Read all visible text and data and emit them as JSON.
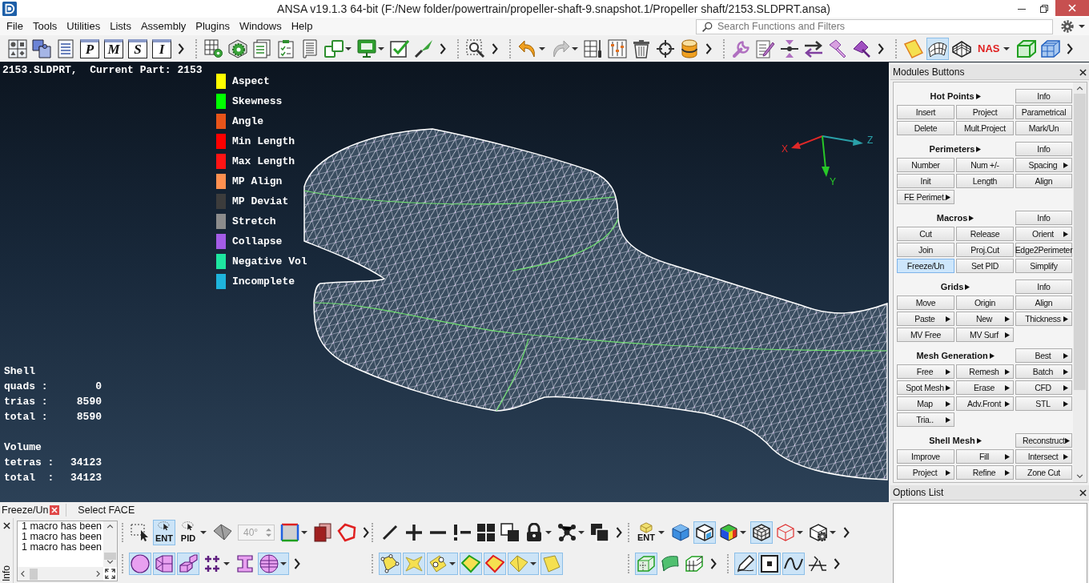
{
  "window": {
    "title": "ANSA v19.1.3 64-bit (F:/New folder/powertrain/propeller-shaft-9.snapshot.1/Propeller shaft/2153.SLDPRT.ansa)"
  },
  "menu": [
    "File",
    "Tools",
    "Utilities",
    "Lists",
    "Assembly",
    "Plugins",
    "Windows",
    "Help"
  ],
  "search": {
    "placeholder": "Search Functions and Filters"
  },
  "toolbar": [
    {
      "items": [
        {
          "kind": "icon",
          "on": false
        },
        {
          "kind": "icon",
          "on": false
        },
        {
          "kind": "icon",
          "on": false
        },
        {
          "kind": "letter",
          "label": "P",
          "on": false
        },
        {
          "kind": "letter",
          "label": "M",
          "on": false
        },
        {
          "kind": "letter",
          "label": "S",
          "on": false
        },
        {
          "kind": "letter",
          "label": "I",
          "on": false
        }
      ],
      "overflow": true
    },
    {
      "items": [
        {
          "kind": "icon",
          "on": false
        },
        {
          "kind": "icon",
          "on": false
        },
        {
          "kind": "icon",
          "on": false
        },
        {
          "kind": "icon",
          "on": false
        },
        {
          "kind": "icon",
          "on": false
        },
        {
          "kind": "icon",
          "on": false
        },
        {
          "kind": "icon",
          "on": false
        },
        {
          "kind": "icon",
          "on": false
        },
        {
          "kind": "icon",
          "on": false
        }
      ],
      "overflow": true
    },
    {
      "items": [
        {
          "kind": "icon",
          "on": false
        }
      ],
      "overflow": true
    },
    {
      "items": [
        {
          "kind": "icon",
          "on": false
        },
        {
          "kind": "icon",
          "on": false
        },
        {
          "kind": "icon",
          "on": false
        },
        {
          "kind": "icon",
          "on": false
        },
        {
          "kind": "icon",
          "on": false
        },
        {
          "kind": "icon",
          "on": false
        },
        {
          "kind": "icon",
          "on": false
        }
      ],
      "overflow": true
    },
    {
      "items": [
        {
          "kind": "icon",
          "on": false
        },
        {
          "kind": "icon",
          "on": false
        },
        {
          "kind": "icon",
          "on": false
        },
        {
          "kind": "icon",
          "on": false
        },
        {
          "kind": "icon",
          "on": false
        },
        {
          "kind": "icon",
          "on": false
        }
      ],
      "overflow": true
    },
    {
      "items": [
        {
          "kind": "icon",
          "on": false
        },
        {
          "kind": "icon",
          "on": true
        },
        {
          "kind": "icon",
          "on": false
        },
        {
          "kind": "text",
          "label": "NAS",
          "on": false
        },
        {
          "kind": "icon",
          "on": false
        },
        {
          "kind": "icon",
          "on": false
        }
      ],
      "overflow": true
    }
  ],
  "viewport": {
    "part_label": "2153.SLDPRT,  Current Part: 2153",
    "legend": [
      {
        "label": "Aspect",
        "color": "#ffff00"
      },
      {
        "label": "Skewness",
        "color": "#00ff00"
      },
      {
        "label": "Angle",
        "color": "#e8541a"
      },
      {
        "label": "Min Length",
        "color": "#ff0000"
      },
      {
        "label": "Max Length",
        "color": "#ff1414"
      },
      {
        "label": "MP Align",
        "color": "#ff9050"
      },
      {
        "label": "MP Deviat",
        "color": "#3c3c3c"
      },
      {
        "label": "Stretch",
        "color": "#8c8c8c"
      },
      {
        "label": "Collapse",
        "color": "#a35ce6"
      },
      {
        "label": "Negative Vol",
        "color": "#1ee6a0"
      },
      {
        "label": "Incomplete",
        "color": "#1eb4dc"
      }
    ],
    "axes": [
      {
        "label": "X"
      },
      {
        "label": "Z"
      },
      {
        "label": "Y"
      }
    ],
    "stats": [
      {
        "heading": "Shell",
        "rows": [
          {
            "label": "quads :",
            "value": "0"
          },
          {
            "label": "trias :",
            "value": "8590"
          },
          {
            "label": "total :",
            "value": "8590"
          }
        ]
      },
      {
        "heading": "Volume",
        "rows": [
          {
            "label": "tetras :",
            "value": "34123"
          },
          {
            "label": "total  :",
            "value": "34123"
          }
        ]
      }
    ]
  },
  "modules": {
    "title": "Modules Buttons",
    "sections": [
      {
        "title": "Hot Points",
        "side": {
          "label": "Info",
          "submenu": false,
          "selected": false
        },
        "rows": [
          [
            {
              "label": "Insert",
              "submenu": false,
              "selected": false
            },
            {
              "label": "Project",
              "submenu": false,
              "selected": false
            },
            {
              "label": "Parametrical",
              "submenu": false,
              "selected": false
            }
          ],
          [
            {
              "label": "Delete",
              "submenu": false,
              "selected": false
            },
            {
              "label": "Mult.Project",
              "submenu": false,
              "selected": false
            },
            {
              "label": "Mark/Un",
              "submenu": false,
              "selected": false
            }
          ]
        ]
      },
      {
        "title": "Perimeters",
        "side": {
          "label": "Info",
          "submenu": false,
          "selected": false
        },
        "rows": [
          [
            {
              "label": "Number",
              "submenu": false,
              "selected": false
            },
            {
              "label": "Num +/-",
              "submenu": false,
              "selected": false
            },
            {
              "label": "Spacing",
              "submenu": true,
              "selected": false
            }
          ],
          [
            {
              "label": "Init",
              "submenu": false,
              "selected": false
            },
            {
              "label": "Length",
              "submenu": false,
              "selected": false
            },
            {
              "label": "Align",
              "submenu": false,
              "selected": false
            }
          ],
          [
            {
              "label": "FE Perimet.",
              "submenu": true,
              "selected": false
            }
          ]
        ]
      },
      {
        "title": "Macros",
        "side": {
          "label": "Info",
          "submenu": false,
          "selected": false
        },
        "rows": [
          [
            {
              "label": "Cut",
              "submenu": false,
              "selected": false
            },
            {
              "label": "Release",
              "submenu": false,
              "selected": false
            },
            {
              "label": "Orient",
              "submenu": true,
              "selected": false
            }
          ],
          [
            {
              "label": "Join",
              "submenu": false,
              "selected": false
            },
            {
              "label": "Proj.Cut",
              "submenu": false,
              "selected": false
            },
            {
              "label": "Edge2Perimeter",
              "submenu": false,
              "selected": false
            }
          ],
          [
            {
              "label": "Freeze/Un",
              "submenu": false,
              "selected": true
            },
            {
              "label": "Set PID",
              "submenu": false,
              "selected": false
            },
            {
              "label": "Simplify",
              "submenu": false,
              "selected": false
            }
          ]
        ]
      },
      {
        "title": "Grids",
        "side": {
          "label": "Info",
          "submenu": false,
          "selected": false
        },
        "rows": [
          [
            {
              "label": "Move",
              "submenu": false,
              "selected": false
            },
            {
              "label": "Origin",
              "submenu": false,
              "selected": false
            },
            {
              "label": "Align",
              "submenu": false,
              "selected": false
            }
          ],
          [
            {
              "label": "Paste",
              "submenu": true,
              "selected": false
            },
            {
              "label": "New",
              "submenu": true,
              "selected": false
            },
            {
              "label": "Thickness",
              "submenu": true,
              "selected": false
            }
          ],
          [
            {
              "label": "MV Free",
              "submenu": false,
              "selected": false
            },
            {
              "label": "MV Surf",
              "submenu": true,
              "selected": false
            }
          ]
        ]
      },
      {
        "title": "Mesh Generation",
        "side": {
          "label": "Best",
          "submenu": true,
          "selected": false
        },
        "rows": [
          [
            {
              "label": "Free",
              "submenu": true,
              "selected": false
            },
            {
              "label": "Remesh",
              "submenu": true,
              "selected": false
            },
            {
              "label": "Batch",
              "submenu": true,
              "selected": false
            }
          ],
          [
            {
              "label": "Spot Mesh",
              "submenu": true,
              "selected": false
            },
            {
              "label": "Erase",
              "submenu": true,
              "selected": false
            },
            {
              "label": "CFD",
              "submenu": true,
              "selected": false
            }
          ],
          [
            {
              "label": "Map",
              "submenu": true,
              "selected": false
            },
            {
              "label": "Adv.Front",
              "submenu": true,
              "selected": false
            },
            {
              "label": "STL",
              "submenu": true,
              "selected": false
            }
          ],
          [
            {
              "label": "Tria..",
              "submenu": true,
              "selected": false
            }
          ]
        ]
      },
      {
        "title": "Shell Mesh",
        "side": {
          "label": "Reconstruct",
          "submenu": true,
          "selected": false
        },
        "rows": [
          [
            {
              "label": "Improve",
              "submenu": false,
              "selected": false
            },
            {
              "label": "Fill",
              "submenu": true,
              "selected": false
            },
            {
              "label": "Intersect",
              "submenu": true,
              "selected": false
            }
          ],
          [
            {
              "label": "Project",
              "submenu": true,
              "selected": false
            },
            {
              "label": "Refine",
              "submenu": true,
              "selected": false
            },
            {
              "label": "Zone Cut",
              "submenu": false,
              "selected": false
            }
          ]
        ]
      }
    ]
  },
  "options": {
    "title": "Options List"
  },
  "bottom": {
    "function": {
      "label": "Freeze/Un"
    },
    "prompt": "Select FACE",
    "info": {
      "tab": "Info",
      "lines": [
        "1 macro has been",
        "1 macro has been",
        "1 macro has been"
      ]
    },
    "toolbars": [
      [
        {
          "items": [
            {
              "kind": "icon",
              "on": false
            },
            {
              "kind": "captioned",
              "label": "ENT",
              "on": true
            },
            {
              "kind": "captioned",
              "label": "PID",
              "on": false
            },
            {
              "kind": "icon",
              "on": false
            },
            {
              "kind": "field",
              "value": "40°",
              "disabled": true
            },
            {
              "kind": "icon",
              "on": false
            },
            {
              "kind": "icon",
              "on": false
            },
            {
              "kind": "icon",
              "on": false
            }
          ],
          "overflow": true
        },
        {
          "items": [
            {
              "kind": "icon",
              "on": false
            },
            {
              "kind": "icon",
              "on": false
            },
            {
              "kind": "icon",
              "on": false
            },
            {
              "kind": "icon",
              "on": false
            },
            {
              "kind": "icon",
              "on": false
            },
            {
              "kind": "icon",
              "on": false
            },
            {
              "kind": "icon",
              "on": false
            },
            {
              "kind": "icon",
              "on": false
            },
            {
              "kind": "icon",
              "on": false
            }
          ],
          "overflow": true
        },
        {
          "items": [
            {
              "kind": "captioned",
              "label": "ENT",
              "on": false
            },
            {
              "kind": "icon",
              "on": false
            },
            {
              "kind": "icon",
              "on": true
            },
            {
              "kind": "icon",
              "on": false
            },
            {
              "kind": "icon",
              "on": true
            },
            {
              "kind": "icon",
              "on": false
            },
            {
              "kind": "icon",
              "on": false
            }
          ],
          "overflow": true
        }
      ],
      [
        {
          "items": [
            {
              "kind": "icon",
              "on": true
            },
            {
              "kind": "icon",
              "on": true
            },
            {
              "kind": "icon",
              "on": true
            },
            {
              "kind": "icon",
              "on": false
            },
            {
              "kind": "icon",
              "on": false
            },
            {
              "kind": "icon",
              "on": true
            }
          ],
          "overflow": true
        },
        {
          "items": [
            {
              "kind": "icon",
              "on": true
            },
            {
              "kind": "icon",
              "on": true
            },
            {
              "kind": "icon",
              "on": true
            },
            {
              "kind": "icon",
              "on": true
            },
            {
              "kind": "icon",
              "on": true
            },
            {
              "kind": "icon",
              "on": true
            },
            {
              "kind": "icon",
              "on": true
            }
          ],
          "overflow": false
        },
        {
          "items": [
            {
              "kind": "icon",
              "on": true
            },
            {
              "kind": "icon",
              "on": false
            },
            {
              "kind": "icon",
              "on": false
            }
          ],
          "overflow": true
        },
        {
          "items": [
            {
              "kind": "icon",
              "on": true
            },
            {
              "kind": "icon",
              "on": true
            },
            {
              "kind": "icon",
              "on": true
            },
            {
              "kind": "icon",
              "on": false
            }
          ],
          "overflow": true
        }
      ]
    ]
  }
}
